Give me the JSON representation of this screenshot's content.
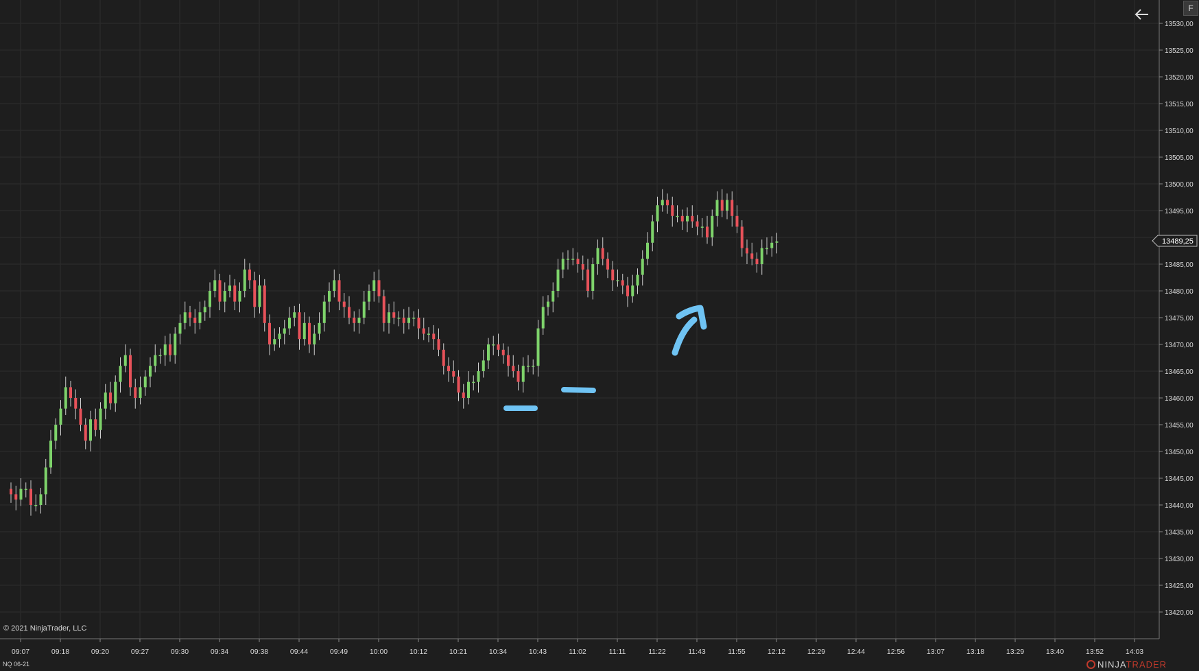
{
  "copyright": "© 2021 NinjaTrader, LLC",
  "instrument": "NQ 06-21",
  "f_button": "F",
  "logo": {
    "ninja": "NINJA",
    "trader": "TRADER"
  },
  "icons": {
    "back": "arrow-left-icon"
  },
  "colors": {
    "background": "#1e1e1e",
    "grid": "#2d2d2d",
    "up": "#7ed36b",
    "down": "#e8525a",
    "wick": "#cfcfcf",
    "annotation": "#6fc3f3",
    "axis_text": "#d8d8d8"
  },
  "chart_data": {
    "type": "candlestick",
    "ylim": [
      13417.5,
      13533
    ],
    "y_ticks": [
      "13530,00",
      "13525,00",
      "13520,00",
      "13515,00",
      "13510,00",
      "13505,00",
      "13500,00",
      "13495,00",
      "13490,00",
      "13485,00",
      "13480,00",
      "13475,00",
      "13470,00",
      "13465,00",
      "13460,00",
      "13455,00",
      "13450,00",
      "13445,00",
      "13440,00",
      "13435,00",
      "13430,00",
      "13425,00",
      "13420,00"
    ],
    "x_ticks": [
      "09:07",
      "09:18",
      "09:20",
      "09:27",
      "09:30",
      "09:34",
      "09:38",
      "09:44",
      "09:49",
      "10:00",
      "10:12",
      "10:21",
      "10:34",
      "10:43",
      "11:02",
      "11:11",
      "11:22",
      "11:43",
      "11:55",
      "12:12",
      "12:29",
      "12:44",
      "12:56",
      "13:07",
      "13:18",
      "13:29",
      "13:40",
      "13:52",
      "14:03"
    ],
    "last_price_label": "13489,25",
    "last_price": 13489.25,
    "grid": true,
    "closes": [
      13442,
      13441,
      13443,
      13443,
      13440,
      13440,
      13442,
      13447,
      13452,
      13455,
      13458,
      13462,
      13460,
      13458,
      13455,
      13452,
      13456,
      13454,
      13458,
      13461,
      13459,
      13463,
      13466,
      13468,
      13462,
      13460,
      13462,
      13464,
      13466,
      13468,
      13468,
      13470,
      13468,
      13472,
      13474,
      13476,
      13475,
      13474,
      13476,
      13477,
      13480,
      13482,
      13478,
      13480,
      13481,
      13478,
      13480,
      13484,
      13482,
      13477,
      13481,
      13474,
      13470,
      13471,
      13472,
      13473,
      13475,
      13476,
      13471,
      13474,
      13470,
      13472,
      13474,
      13478,
      13480,
      13482,
      13478,
      13477,
      13475,
      13474,
      13475,
      13478,
      13480,
      13482,
      13479,
      13474,
      13476,
      13475,
      13475,
      13474,
      13475,
      13475,
      13473,
      13472,
      13472,
      13471,
      13469,
      13466,
      13465,
      13464,
      13461,
      13460,
      13463,
      13463,
      13465,
      13467,
      13470,
      13470,
      13469,
      13468,
      13466,
      13465,
      13463,
      13466,
      13466,
      13466,
      13473,
      13477,
      13478,
      13480,
      13484,
      13486,
      13486,
      13486,
      13485,
      13484,
      13480,
      13485,
      13488,
      13486,
      13484,
      13482,
      13482,
      13481,
      13479,
      13481,
      13483,
      13486,
      13489,
      13493,
      13496,
      13497,
      13496,
      13494,
      13494,
      13493,
      13494,
      13493,
      13492,
      13492,
      13490,
      13494,
      13497,
      13495,
      13497,
      13494,
      13492,
      13488,
      13487,
      13486,
      13485,
      13488,
      13488,
      13489,
      13489.25
    ]
  }
}
